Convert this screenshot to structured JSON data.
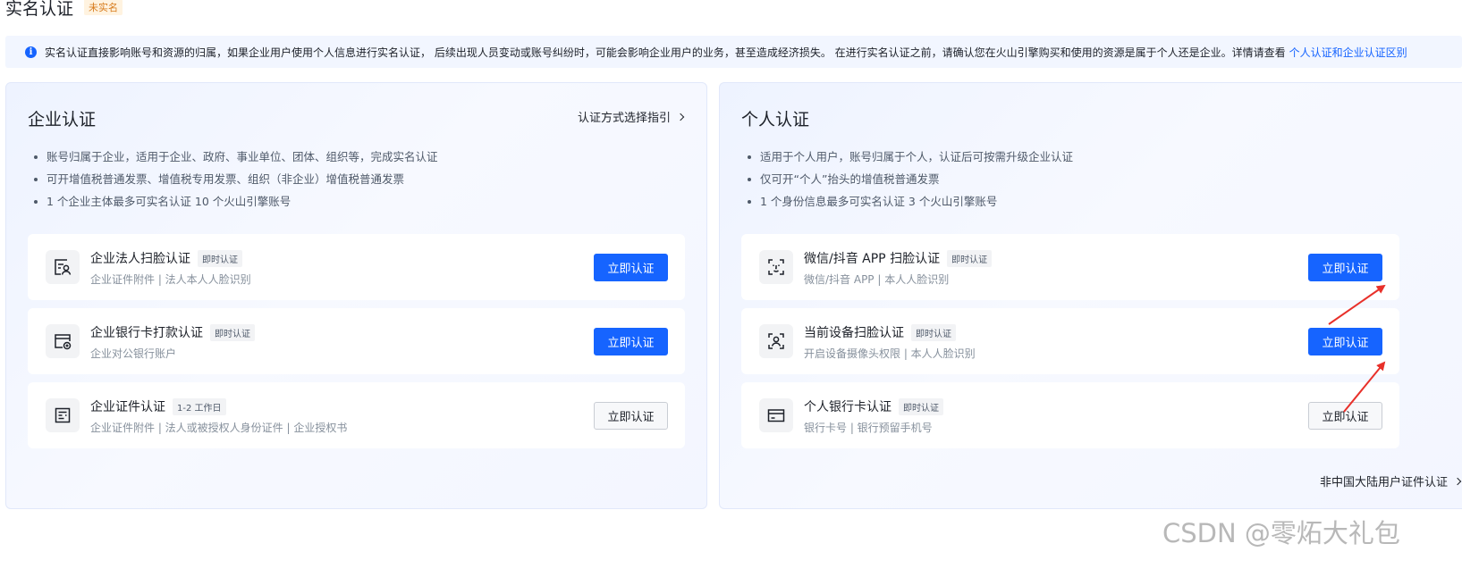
{
  "page": {
    "title": "实名认证",
    "status_badge": "未实名"
  },
  "notice": {
    "text": "实名认证直接影响账号和资源的归属，如果企业用户使用个人信息进行实名认证， 后续出现人员变动或账号纠纷时，可能会影响企业用户的业务，甚至造成经济损失。 在进行实名认证之前，请确认您在火山引擎购买和使用的资源是属于个人还是企业。详情请查看",
    "link": "个人认证和企业认证区别"
  },
  "enterprise": {
    "title": "企业认证",
    "guide_link": "认证方式选择指引",
    "bullets": [
      "账号归属于企业，适用于企业、政府、事业单位、团体、组织等，完成实名认证",
      "可开增值税普通发票、增值税专用发票、组织（非企业）增值税普通发票",
      "1 个企业主体最多可实名认证 10 个火山引擎账号"
    ],
    "methods": [
      {
        "title": "企业法人扫脸认证",
        "tag": "即时认证",
        "desc": "企业证件附件 | 法人本人人脸识别",
        "button": "立即认证",
        "icon": "face-id-card-icon"
      },
      {
        "title": "企业银行卡打款认证",
        "tag": "即时认证",
        "desc": "企业对公银行账户",
        "button": "立即认证",
        "icon": "bank-transfer-icon"
      },
      {
        "title": "企业证件认证",
        "tag": "1-2 工作日",
        "desc": "企业证件附件 | 法人或被授权人身份证件 | 企业授权书",
        "button": "立即认证",
        "icon": "document-icon"
      }
    ]
  },
  "personal": {
    "title": "个人认证",
    "bullets": [
      "适用于个人用户，账号归属于个人，认证后可按需升级企业认证",
      "仅可开“个人”抬头的增值税普通发票",
      "1 个身份信息最多可实名认证 3 个火山引擎账号"
    ],
    "methods": [
      {
        "title": "微信/抖音 APP 扫脸认证",
        "tag": "即时认证",
        "desc": "微信/抖音 APP | 本人人脸识别",
        "button": "立即认证",
        "icon": "face-scan-icon"
      },
      {
        "title": "当前设备扫脸认证",
        "tag": "即时认证",
        "desc": "开启设备摄像头权限 | 本人人脸识别",
        "button": "立即认证",
        "icon": "device-face-scan-icon"
      },
      {
        "title": "个人银行卡认证",
        "tag": "即时认证",
        "desc": "银行卡号 | 银行预留手机号",
        "button": "立即认证",
        "icon": "bank-card-icon"
      }
    ],
    "foot_link": "非中国大陆用户证件认证"
  },
  "watermark": "CSDN @零炻大礼包",
  "colors": {
    "primary": "#1664ff",
    "annotation_arrow": "#e8302a",
    "badge_text": "#d77b1c"
  }
}
